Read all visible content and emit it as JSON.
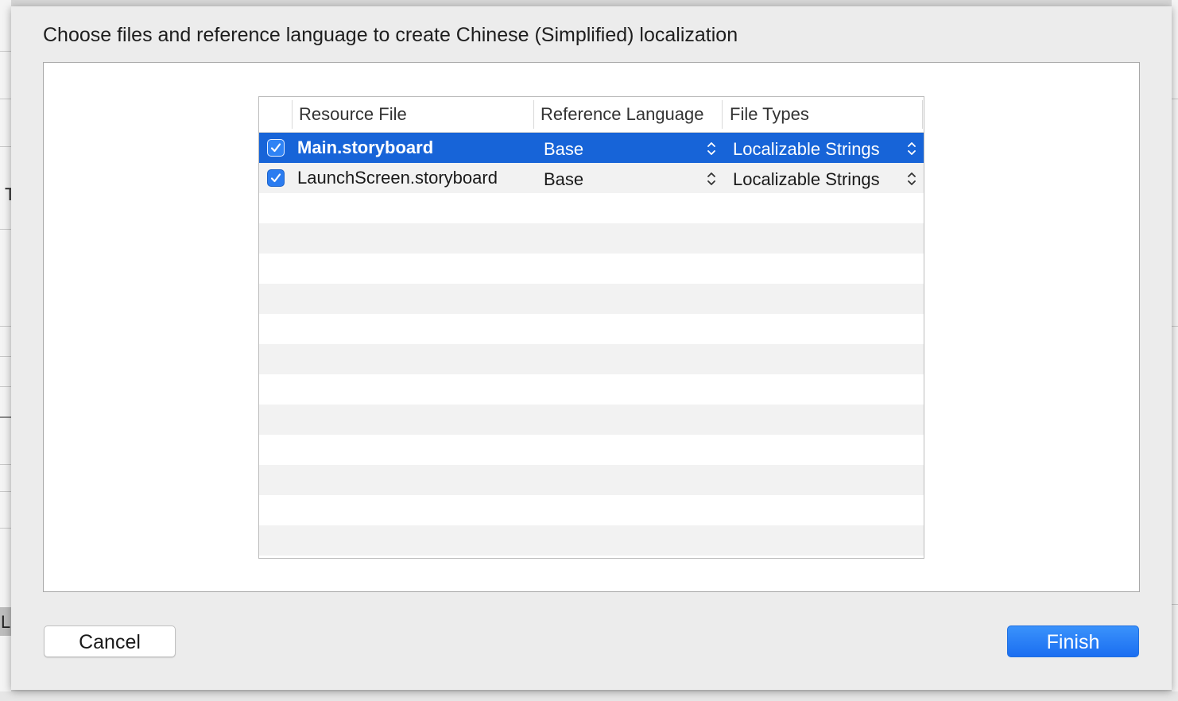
{
  "dialog": {
    "title": "Choose files and reference language to create Chinese (Simplified) localization"
  },
  "table": {
    "columns": [
      "Resource File",
      "Reference Language",
      "File Types"
    ],
    "rows": [
      {
        "checked": true,
        "file": "Main.storyboard",
        "language": "Base",
        "file_type": "Localizable Strings",
        "selected": true
      },
      {
        "checked": true,
        "file": "LaunchScreen.storyboard",
        "language": "Base",
        "file_type": "Localizable Strings",
        "selected": false
      }
    ]
  },
  "buttons": {
    "cancel": "Cancel",
    "finish": "Finish"
  },
  "background": {
    "left_glyph_1": "T",
    "left_glyph_2": "L"
  },
  "colors": {
    "selection": "#1764d8",
    "checkbox": "#2b7cf0",
    "primary_button": "#1b6ef1"
  }
}
